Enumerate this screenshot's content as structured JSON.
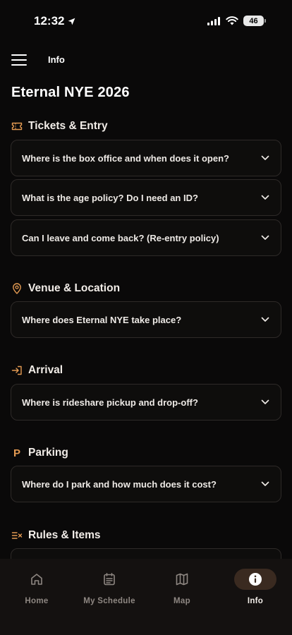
{
  "status_bar": {
    "time": "12:32",
    "battery": "46"
  },
  "header": {
    "title": "Info"
  },
  "page": {
    "title": "Eternal NYE 2026"
  },
  "sections": [
    {
      "title": "Tickets & Entry",
      "icon": "ticket-icon",
      "questions": [
        "Where is the box office and when does it open?",
        "What is the age policy? Do I need an ID?",
        "Can I leave and come back? (Re-entry policy)"
      ]
    },
    {
      "title": "Venue & Location",
      "icon": "map-pin-icon",
      "questions": [
        "Where does Eternal NYE take place?"
      ]
    },
    {
      "title": "Arrival",
      "icon": "log-in-icon",
      "questions": [
        "Where is rideshare pickup and drop-off?"
      ]
    },
    {
      "title": "Parking",
      "icon": "parking-icon",
      "icon_glyph": "P",
      "questions": [
        "Where do I park and how much does it cost?"
      ]
    },
    {
      "title": "Rules & Items",
      "icon": "list-check-icon",
      "questions": []
    }
  ],
  "tabbar": {
    "tabs": [
      {
        "label": "Home",
        "icon": "home-icon"
      },
      {
        "label": "My Schedule",
        "icon": "schedule-icon"
      },
      {
        "label": "Map",
        "icon": "map-icon"
      },
      {
        "label": "Info",
        "icon": "info-icon",
        "active": true
      }
    ]
  },
  "colors": {
    "background": "#0a0909",
    "accent": "#e39a52",
    "card_border": "#2e2a28",
    "tab_active_pill": "#3a2a20"
  }
}
